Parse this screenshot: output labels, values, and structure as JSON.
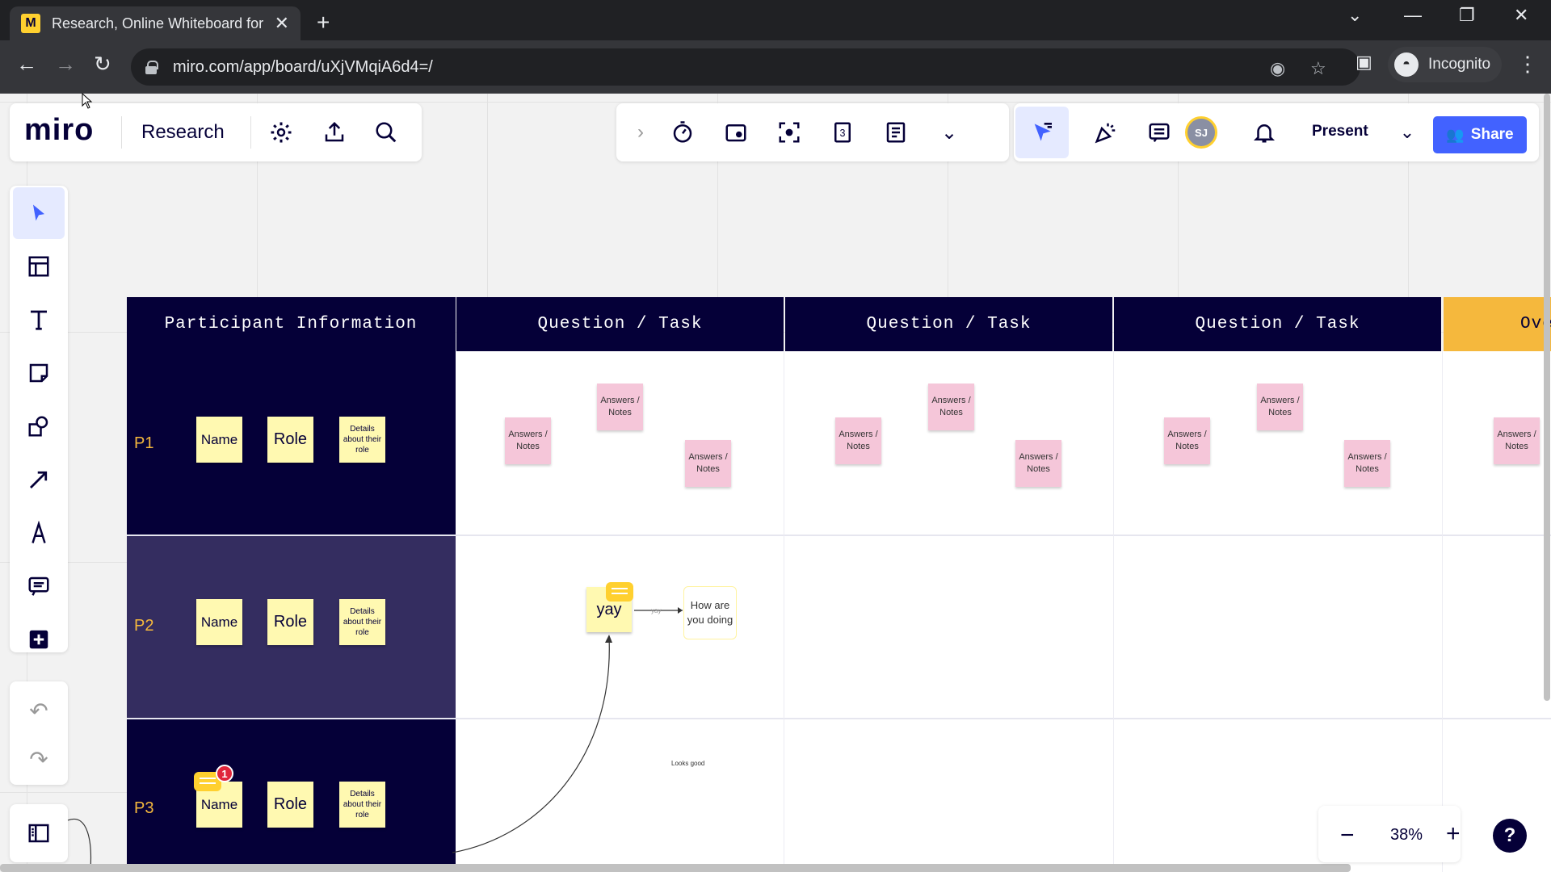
{
  "browser": {
    "tab_title": "Research, Online Whiteboard for",
    "url": "miro.com/app/board/uXjVMqiA6d4=/",
    "profile_label": "Incognito"
  },
  "header": {
    "logo": "miro",
    "board_name": "Research",
    "present_label": "Present",
    "share_label": "Share",
    "user_initials": "SJ"
  },
  "table": {
    "headers": [
      "Participant Information",
      "Question / Task",
      "Question / Task",
      "Question / Task",
      "Overa"
    ],
    "rows": [
      "P1",
      "P2",
      "P3"
    ],
    "sticky": {
      "name": "Name",
      "role": "Role",
      "details": "Details about their role",
      "answers": "Answers / Notes"
    }
  },
  "canvas_items": {
    "yay_note": "yay",
    "connector_label": "yay",
    "how_are_you": "How are you doing",
    "looks_good": "Looks good",
    "comment_badge": "1"
  },
  "zoom": {
    "level": "38%"
  },
  "help": "?"
}
